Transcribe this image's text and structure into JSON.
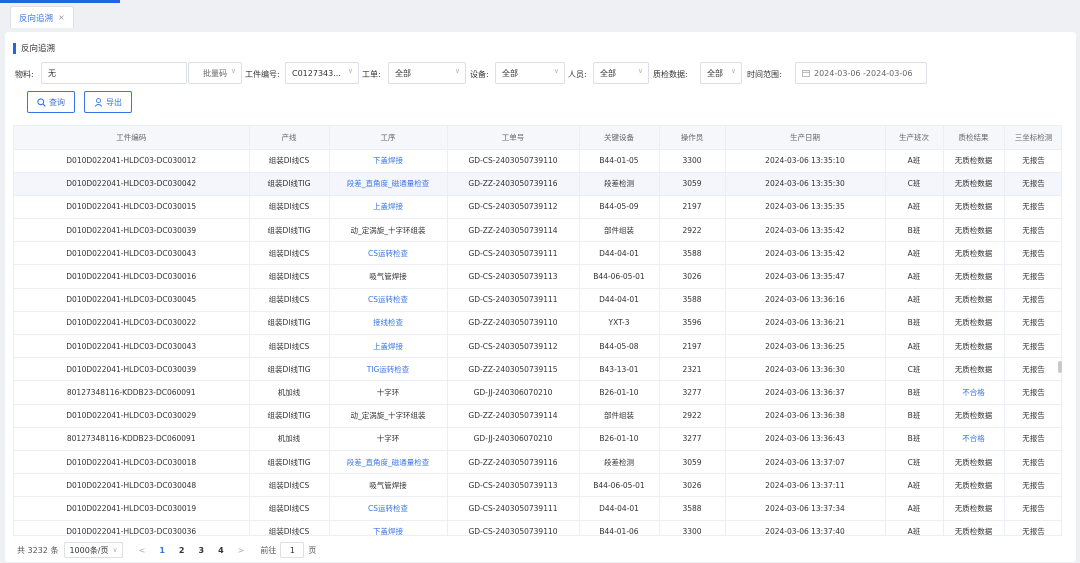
{
  "tab": {
    "label": "反向追溯",
    "close": "×"
  },
  "page_title": "反向追溯",
  "filters": {
    "material_label": "物料:",
    "material_value": "无",
    "batch_placeholder": "批量码",
    "workpiece_label": "工件编号:",
    "workpiece_value": "C0127343...",
    "workorder_label": "工单:",
    "workorder_value": "全部",
    "equipment_label": "设备:",
    "equipment_value": "全部",
    "person_label": "人员:",
    "person_value": "全部",
    "qc_label": "质检数据:",
    "qc_value": "全部",
    "time_label": "时间范围:",
    "time_value": "2024-03-06 -2024-03-06"
  },
  "buttons": {
    "query": "查询",
    "export": "导出"
  },
  "icons": {
    "search": "search-icon",
    "export": "export-icon",
    "calendar": "calendar-icon",
    "caret": "chevron-down-icon"
  },
  "colors": {
    "accent": "#3a74e6",
    "brand_bar": "#1f66e0"
  },
  "table": {
    "columns": [
      "工件编码",
      "产线",
      "工序",
      "工单号",
      "关键设备",
      "操作员",
      "生产日期",
      "生产班次",
      "质检结果",
      "三坐标检测"
    ],
    "rows": [
      [
        "D010D022041-HLDC03-DC030012",
        "组装DI线CS",
        "下盖焊接",
        "GD-CS-2403050739110",
        "B44-01-05",
        "3300",
        "2024-03-06 13:35:10",
        "A班",
        "无质检数据",
        "无报告"
      ],
      [
        "D010D022041-HLDC03-DC030042",
        "组装DI线TIG",
        "段差_直角度_磁通量检查",
        "GD-ZZ-2403050739116",
        "段差检测",
        "3059",
        "2024-03-06 13:35:30",
        "C班",
        "无质检数据",
        "无报告"
      ],
      [
        "D010D022041-HLDC03-DC030015",
        "组装DI线CS",
        "上盖焊接",
        "GD-CS-2403050739112",
        "B44-05-09",
        "2197",
        "2024-03-06 13:35:35",
        "A班",
        "无质检数据",
        "无报告"
      ],
      [
        "D010D022041-HLDC03-DC030039",
        "组装DI线TIG",
        "动_定涡旋_十字环组装",
        "GD-ZZ-2403050739114",
        "部件组装",
        "2922",
        "2024-03-06 13:35:42",
        "B班",
        "无质检数据",
        "无报告"
      ],
      [
        "D010D022041-HLDC03-DC030043",
        "组装DI线CS",
        "CS运转检查",
        "GD-CS-2403050739111",
        "D44-04-01",
        "3588",
        "2024-03-06 13:35:42",
        "A班",
        "无质检数据",
        "无报告"
      ],
      [
        "D010D022041-HLDC03-DC030016",
        "组装DI线CS",
        "吸气管焊接",
        "GD-CS-2403050739113",
        "B44-06-05-01",
        "3026",
        "2024-03-06 13:35:47",
        "A班",
        "无质检数据",
        "无报告"
      ],
      [
        "D010D022041-HLDC03-DC030045",
        "组装DI线CS",
        "CS运转检查",
        "GD-CS-2403050739111",
        "D44-04-01",
        "3588",
        "2024-03-06 13:36:16",
        "A班",
        "无质检数据",
        "无报告"
      ],
      [
        "D010D022041-HLDC03-DC030022",
        "组装DI线TIG",
        "接线检查",
        "GD-ZZ-2403050739110",
        "YXT-3",
        "3596",
        "2024-03-06 13:36:21",
        "B班",
        "无质检数据",
        "无报告"
      ],
      [
        "D010D022041-HLDC03-DC030043",
        "组装DI线CS",
        "上盖焊接",
        "GD-CS-2403050739112",
        "B44-05-08",
        "2197",
        "2024-03-06 13:36:25",
        "A班",
        "无质检数据",
        "无报告"
      ],
      [
        "D010D022041-HLDC03-DC030039",
        "组装DI线TIG",
        "TIG运转检查",
        "GD-ZZ-2403050739115",
        "B43-13-01",
        "2321",
        "2024-03-06 13:36:30",
        "C班",
        "无质检数据",
        "无报告"
      ],
      [
        "80127348116-KDDB23-DC060091",
        "机加线",
        "十字环",
        "GD-JJ-240306070210",
        "B26-01-10",
        "3277",
        "2024-03-06 13:36:37",
        "B班",
        "不合格",
        "无报告"
      ],
      [
        "D010D022041-HLDC03-DC030029",
        "组装DI线TIG",
        "动_定涡旋_十字环组装",
        "GD-ZZ-2403050739114",
        "部件组装",
        "2922",
        "2024-03-06 13:36:38",
        "B班",
        "无质检数据",
        "无报告"
      ],
      [
        "80127348116-KDDB23-DC060091",
        "机加线",
        "十字环",
        "GD-JJ-240306070210",
        "B26-01-10",
        "3277",
        "2024-03-06 13:36:43",
        "B班",
        "不合格",
        "无报告"
      ],
      [
        "D010D022041-HLDC03-DC030018",
        "组装DI线TIG",
        "段差_直角度_磁通量检查",
        "GD-ZZ-2403050739116",
        "段差检测",
        "3059",
        "2024-03-06 13:37:07",
        "C班",
        "无质检数据",
        "无报告"
      ],
      [
        "D010D022041-HLDC03-DC030048",
        "组装DI线CS",
        "吸气管焊接",
        "GD-CS-2403050739113",
        "B44-06-05-01",
        "3026",
        "2024-03-06 13:37:11",
        "A班",
        "无质检数据",
        "无报告"
      ],
      [
        "D010D022041-HLDC03-DC030019",
        "组装DI线CS",
        "CS运转检查",
        "GD-CS-2403050739111",
        "D44-04-01",
        "3588",
        "2024-03-06 13:37:34",
        "A班",
        "无质检数据",
        "无报告"
      ],
      [
        "D010D022041-HLDC03-DC030036",
        "组装DI线CS",
        "下盖焊接",
        "GD-CS-2403050739110",
        "B44-01-06",
        "3300",
        "2024-03-06 13:37:40",
        "A班",
        "无质检数据",
        "无报告"
      ]
    ],
    "link_process_rows": [
      0,
      1,
      2,
      4,
      6,
      7,
      8,
      9,
      13,
      15,
      16
    ],
    "link_result_rows": [
      10,
      12
    ],
    "highlight_row": 1
  },
  "pager": {
    "total": "共 3232 条",
    "page_size": "1000条/页",
    "prev": "<",
    "pages": [
      "1",
      "2",
      "3",
      "4"
    ],
    "active_page": "1",
    "next": ">",
    "goto_label": "前往",
    "goto_value": "1",
    "page_suffix": "页"
  }
}
